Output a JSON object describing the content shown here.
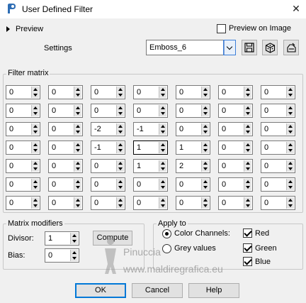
{
  "window": {
    "title": "User Defined Filter",
    "close_glyph": "✕",
    "app_icon": "paintshop-icon"
  },
  "preview": {
    "label": "Preview",
    "preview_on_image_label": "Preview on Image",
    "preview_on_image_checked": false
  },
  "settings": {
    "label": "Settings",
    "preset_value": "Emboss_6",
    "tool_icons": [
      "save-icon",
      "dice-icon",
      "delete-icon"
    ]
  },
  "filter_matrix": {
    "title": "Filter matrix",
    "rows": [
      [
        "0",
        "0",
        "0",
        "0",
        "0",
        "0",
        "0"
      ],
      [
        "0",
        "0",
        "0",
        "0",
        "0",
        "0",
        "0"
      ],
      [
        "0",
        "0",
        "-2",
        "-1",
        "0",
        "0",
        "0"
      ],
      [
        "0",
        "0",
        "-1",
        "1",
        "1",
        "0",
        "0"
      ],
      [
        "0",
        "0",
        "0",
        "1",
        "2",
        "0",
        "0"
      ],
      [
        "0",
        "0",
        "0",
        "0",
        "0",
        "0",
        "0"
      ],
      [
        "0",
        "0",
        "0",
        "0",
        "0",
        "0",
        "0"
      ]
    ]
  },
  "modifiers": {
    "title": "Matrix modifiers",
    "divisor_label": "Divisor:",
    "divisor_value": "1",
    "compute_label": "Compute",
    "bias_label": "Bias:",
    "bias_value": "0"
  },
  "apply_to": {
    "title": "Apply to",
    "color_channels_label": "Color Channels:",
    "grey_values_label": "Grey values",
    "selected": "color_channels",
    "channels": [
      {
        "label": "Red",
        "checked": true
      },
      {
        "label": "Green",
        "checked": true
      },
      {
        "label": "Blue",
        "checked": true
      }
    ]
  },
  "footer": {
    "ok_label": "OK",
    "cancel_label": "Cancel",
    "help_label": "Help"
  },
  "watermark": {
    "line1": "Pinuccia",
    "line2": "www.maldiregrafica.eu"
  }
}
